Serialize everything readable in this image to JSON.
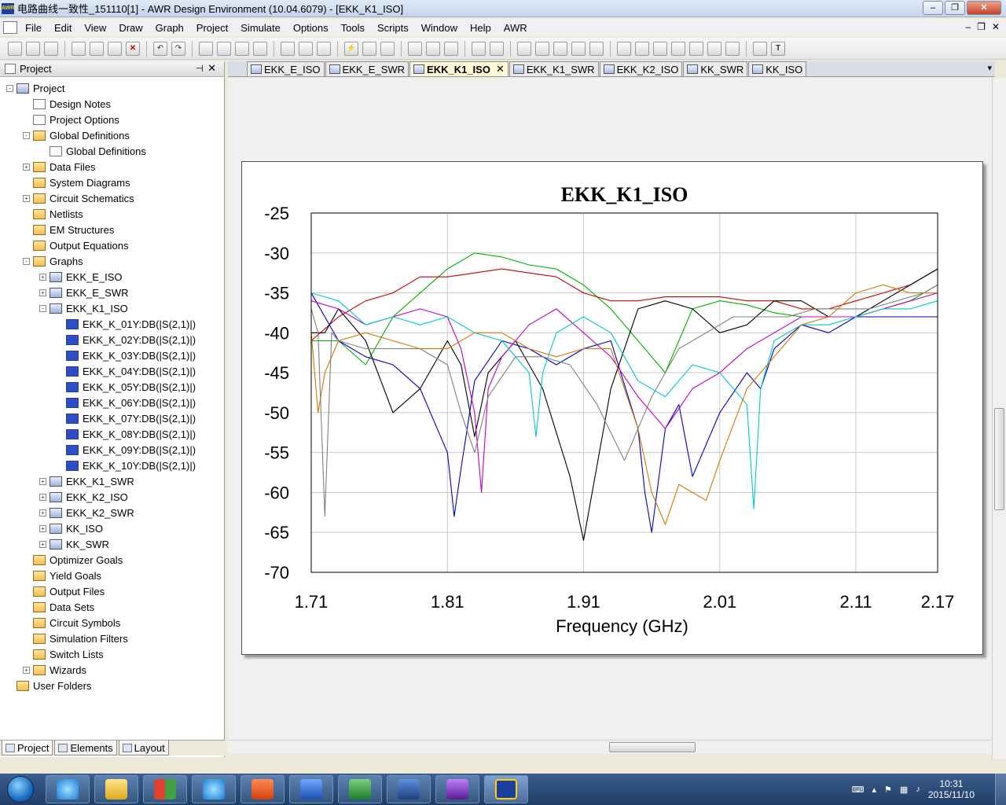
{
  "window": {
    "title": "电路曲线一致性_151110[1] - AWR Design Environment (10.04.6079) - [EKK_K1_ISO]",
    "app_icon": "AWR",
    "buttons": [
      "–",
      "❐",
      "✕"
    ]
  },
  "menu": {
    "items": [
      "File",
      "Edit",
      "View",
      "Draw",
      "Graph",
      "Project",
      "Simulate",
      "Options",
      "Tools",
      "Scripts",
      "Window",
      "Help",
      "AWR"
    ],
    "mdi_buttons": [
      "–",
      "❐",
      "✕"
    ]
  },
  "project_panel": {
    "title": "Project",
    "pin": "⊣",
    "close": "✕",
    "tree": [
      {
        "label": "Project",
        "level": 0,
        "expander": "-",
        "icon": "project-icon"
      },
      {
        "label": "Design Notes",
        "level": 1,
        "expander": "",
        "icon": "notes-icon"
      },
      {
        "label": "Project Options",
        "level": 1,
        "expander": "",
        "icon": "options-icon"
      },
      {
        "label": "Global Definitions",
        "level": 1,
        "expander": "-",
        "icon": "folder-icon"
      },
      {
        "label": "Global Definitions",
        "level": 2,
        "expander": "",
        "icon": "definitions-icon"
      },
      {
        "label": "Data Files",
        "level": 1,
        "expander": "+",
        "icon": "folder-icon"
      },
      {
        "label": "System Diagrams",
        "level": 1,
        "expander": "",
        "icon": "folder-icon"
      },
      {
        "label": "Circuit Schematics",
        "level": 1,
        "expander": "+",
        "icon": "folder-icon"
      },
      {
        "label": "Netlists",
        "level": 1,
        "expander": "",
        "icon": "folder-icon"
      },
      {
        "label": "EM Structures",
        "level": 1,
        "expander": "",
        "icon": "folder-icon"
      },
      {
        "label": "Output Equations",
        "level": 1,
        "expander": "",
        "icon": "folder-icon"
      },
      {
        "label": "Graphs",
        "level": 1,
        "expander": "-",
        "icon": "folder-icon"
      },
      {
        "label": "EKK_E_ISO",
        "level": 2,
        "expander": "+",
        "icon": "graph-icon"
      },
      {
        "label": "EKK_E_SWR",
        "level": 2,
        "expander": "+",
        "icon": "graph-icon"
      },
      {
        "label": "EKK_K1_ISO",
        "level": 2,
        "expander": "-",
        "icon": "graph-icon"
      },
      {
        "label": "EKK_K_01Y:DB(|S(2,1)|)",
        "level": 3,
        "expander": "",
        "icon": "trace-icon"
      },
      {
        "label": "EKK_K_02Y:DB(|S(2,1)|)",
        "level": 3,
        "expander": "",
        "icon": "trace-icon"
      },
      {
        "label": "EKK_K_03Y:DB(|S(2,1)|)",
        "level": 3,
        "expander": "",
        "icon": "trace-icon"
      },
      {
        "label": "EKK_K_04Y:DB(|S(2,1)|)",
        "level": 3,
        "expander": "",
        "icon": "trace-icon"
      },
      {
        "label": "EKK_K_05Y:DB(|S(2,1)|)",
        "level": 3,
        "expander": "",
        "icon": "trace-icon"
      },
      {
        "label": "EKK_K_06Y:DB(|S(2,1)|)",
        "level": 3,
        "expander": "",
        "icon": "trace-icon"
      },
      {
        "label": "EKK_K_07Y:DB(|S(2,1)|)",
        "level": 3,
        "expander": "",
        "icon": "trace-icon"
      },
      {
        "label": "EKK_K_08Y:DB(|S(2,1)|)",
        "level": 3,
        "expander": "",
        "icon": "trace-icon"
      },
      {
        "label": "EKK_K_09Y:DB(|S(2,1)|)",
        "level": 3,
        "expander": "",
        "icon": "trace-icon"
      },
      {
        "label": "EKK_K_10Y:DB(|S(2,1)|)",
        "level": 3,
        "expander": "",
        "icon": "trace-icon"
      },
      {
        "label": "EKK_K1_SWR",
        "level": 2,
        "expander": "+",
        "icon": "graph-icon"
      },
      {
        "label": "EKK_K2_ISO",
        "level": 2,
        "expander": "+",
        "icon": "graph-icon"
      },
      {
        "label": "EKK_K2_SWR",
        "level": 2,
        "expander": "+",
        "icon": "graph-icon"
      },
      {
        "label": "KK_ISO",
        "level": 2,
        "expander": "+",
        "icon": "graph-icon"
      },
      {
        "label": "KK_SWR",
        "level": 2,
        "expander": "+",
        "icon": "graph-icon"
      },
      {
        "label": "Optimizer Goals",
        "level": 1,
        "expander": "",
        "icon": "folder-icon"
      },
      {
        "label": "Yield Goals",
        "level": 1,
        "expander": "",
        "icon": "folder-icon"
      },
      {
        "label": "Output Files",
        "level": 1,
        "expander": "",
        "icon": "folder-icon"
      },
      {
        "label": "Data Sets",
        "level": 1,
        "expander": "",
        "icon": "folder-icon"
      },
      {
        "label": "Circuit Symbols",
        "level": 1,
        "expander": "",
        "icon": "folder-icon"
      },
      {
        "label": "Simulation Filters",
        "level": 1,
        "expander": "",
        "icon": "folder-icon"
      },
      {
        "label": "Switch Lists",
        "level": 1,
        "expander": "",
        "icon": "folder-icon"
      },
      {
        "label": "Wizards",
        "level": 1,
        "expander": "+",
        "icon": "folder-icon"
      },
      {
        "label": "User Folders",
        "level": 0,
        "expander": "",
        "icon": "folder-icon"
      }
    ],
    "bottom_tabs": [
      "Project",
      "Elements",
      "Layout"
    ]
  },
  "doc_tabs": [
    {
      "label": "EKK_E_ISO",
      "active": false
    },
    {
      "label": "EKK_E_SWR",
      "active": false
    },
    {
      "label": "EKK_K1_ISO",
      "active": true
    },
    {
      "label": "EKK_K1_SWR",
      "active": false
    },
    {
      "label": "EKK_K2_ISO",
      "active": false
    },
    {
      "label": "KK_SWR",
      "active": false
    },
    {
      "label": "KK_ISO",
      "active": false
    }
  ],
  "tab_close": "✕",
  "tab_menu_arrow": "▾",
  "chart_data": {
    "type": "line",
    "title": "EKK_K1_ISO",
    "xlabel": "Frequency (GHz)",
    "ylabel": "",
    "xlim": [
      1.71,
      2.17
    ],
    "ylim": [
      -70,
      -25
    ],
    "xticks": [
      "1.71",
      "1.81",
      "1.91",
      "2.01",
      "2.11",
      "2.17"
    ],
    "xtick_values": [
      1.71,
      1.81,
      1.91,
      2.01,
      2.11,
      2.17
    ],
    "yticks": [
      "-25",
      "-30",
      "-35",
      "-40",
      "-45",
      "-50",
      "-55",
      "-60",
      "-65",
      "-70"
    ],
    "ytick_values": [
      -25,
      -30,
      -35,
      -40,
      -45,
      -50,
      -55,
      -60,
      -65,
      -70
    ],
    "grid": true,
    "series": [
      {
        "color": "#00b000",
        "x": [
          1.71,
          1.73,
          1.75,
          1.77,
          1.79,
          1.81,
          1.83,
          1.85,
          1.87,
          1.89,
          1.91,
          1.93,
          1.95,
          1.97,
          1.99,
          2.01,
          2.03,
          2.05,
          2.07,
          2.09,
          2.11,
          2.13,
          2.15,
          2.17
        ],
        "y": [
          -41,
          -41,
          -44,
          -38,
          -35,
          -32,
          -30,
          -30.5,
          -31.5,
          -32,
          -34,
          -37,
          -41,
          -45,
          -37,
          -36,
          -36.5,
          -37.5,
          -38,
          -38,
          -38,
          -37,
          -36,
          -34
        ]
      },
      {
        "color": "#c00000",
        "x": [
          1.71,
          1.73,
          1.75,
          1.77,
          1.79,
          1.81,
          1.83,
          1.85,
          1.87,
          1.89,
          1.91,
          1.93,
          1.95,
          1.97,
          1.99,
          2.01,
          2.03,
          2.05,
          2.07,
          2.09,
          2.11,
          2.13,
          2.15,
          2.17
        ],
        "y": [
          -41,
          -38,
          -36,
          -35,
          -33,
          -33,
          -32.5,
          -32,
          -32.5,
          -33,
          -35,
          -36,
          -36,
          -35.5,
          -35.5,
          -35.5,
          -36,
          -36,
          -37,
          -37,
          -36,
          -35,
          -34,
          -32
        ]
      },
      {
        "color": "#000000",
        "x": [
          1.71,
          1.72,
          1.73,
          1.75,
          1.77,
          1.79,
          1.81,
          1.82,
          1.83,
          1.84,
          1.86,
          1.88,
          1.9,
          1.91,
          1.93,
          1.95,
          1.97,
          1.99,
          2.01,
          2.03,
          2.05,
          2.07,
          2.09,
          2.11,
          2.13,
          2.15,
          2.17
        ],
        "y": [
          -40,
          -40,
          -37,
          -41,
          -50,
          -47,
          -41,
          -44,
          -53,
          -45,
          -41,
          -47,
          -58,
          -66,
          -47,
          -37,
          -36,
          -37,
          -40,
          -39,
          -36,
          -36,
          -38,
          -38,
          -36,
          -34,
          -32
        ]
      },
      {
        "color": "#0000c0",
        "x": [
          1.71,
          1.73,
          1.75,
          1.77,
          1.79,
          1.81,
          1.815,
          1.82,
          1.83,
          1.85,
          1.87,
          1.89,
          1.91,
          1.93,
          1.95,
          1.955,
          1.96,
          1.97,
          1.98,
          1.99,
          2.01,
          2.03,
          2.04,
          2.05,
          2.07,
          2.09,
          2.11,
          2.13,
          2.15,
          2.17
        ],
        "y": [
          -35,
          -41,
          -43,
          -44,
          -47,
          -55,
          -63,
          -57,
          -46,
          -41,
          -42,
          -44,
          -42,
          -41,
          -52,
          -60,
          -65,
          -52,
          -49,
          -58,
          -50,
          -45,
          -47,
          -42,
          -39,
          -40,
          -38,
          -38,
          -38,
          -38
        ]
      },
      {
        "color": "#c000c0",
        "x": [
          1.71,
          1.73,
          1.75,
          1.77,
          1.79,
          1.81,
          1.82,
          1.83,
          1.835,
          1.84,
          1.85,
          1.87,
          1.89,
          1.91,
          1.93,
          1.95,
          1.97,
          1.99,
          2.01,
          2.03,
          2.05,
          2.07,
          2.09,
          2.11,
          2.13,
          2.15,
          2.17
        ],
        "y": [
          -36,
          -37,
          -39,
          -38,
          -37,
          -38,
          -42,
          -50,
          -60,
          -47,
          -43,
          -39,
          -37,
          -40,
          -43,
          -48,
          -52,
          -47,
          -45,
          -42,
          -40,
          -38,
          -38,
          -38,
          -37,
          -36,
          -35
        ]
      },
      {
        "color": "#00c8c8",
        "x": [
          1.71,
          1.73,
          1.75,
          1.77,
          1.79,
          1.81,
          1.83,
          1.85,
          1.87,
          1.875,
          1.88,
          1.89,
          1.91,
          1.93,
          1.95,
          1.97,
          1.99,
          2.01,
          2.03,
          2.035,
          2.04,
          2.05,
          2.07,
          2.09,
          2.11,
          2.13,
          2.15,
          2.17
        ],
        "y": [
          -35,
          -36,
          -39,
          -38,
          -39,
          -38,
          -40,
          -41,
          -45,
          -53,
          -45,
          -40,
          -38,
          -40,
          -46,
          -48,
          -44,
          -45,
          -49,
          -62,
          -47,
          -41,
          -39,
          -39,
          -38,
          -37,
          -37,
          -36
        ]
      },
      {
        "color": "#d07800",
        "x": [
          1.71,
          1.715,
          1.72,
          1.73,
          1.75,
          1.77,
          1.79,
          1.81,
          1.83,
          1.85,
          1.87,
          1.89,
          1.91,
          1.93,
          1.95,
          1.96,
          1.97,
          1.98,
          1.99,
          2.0,
          2.01,
          2.03,
          2.05,
          2.07,
          2.09,
          2.11,
          2.13,
          2.15,
          2.17
        ],
        "y": [
          -40,
          -50,
          -45,
          -41,
          -40,
          -41,
          -42,
          -42,
          -40,
          -40,
          -42,
          -43,
          -42,
          -42,
          -52,
          -60,
          -64,
          -59,
          -60,
          -61,
          -56,
          -47,
          -43,
          -39,
          -38,
          -35,
          -34,
          -35,
          -35
        ]
      },
      {
        "color": "#808080",
        "x": [
          1.71,
          1.715,
          1.72,
          1.725,
          1.73,
          1.75,
          1.77,
          1.79,
          1.81,
          1.82,
          1.83,
          1.84,
          1.86,
          1.88,
          1.9,
          1.92,
          1.94,
          1.96,
          1.98,
          2.0,
          2.02,
          2.04,
          2.06,
          2.08,
          2.1,
          2.12,
          2.14,
          2.16,
          2.17
        ],
        "y": [
          -37,
          -40,
          -63,
          -40,
          -41,
          -42,
          -42,
          -42,
          -44,
          -50,
          -55,
          -48,
          -43,
          -43,
          -44,
          -49,
          -56,
          -48,
          -42,
          -40,
          -38,
          -38,
          -38,
          -37,
          -37,
          -37,
          -36,
          -35,
          -34
        ]
      }
    ]
  },
  "taskbar": {
    "time": "10:31",
    "date": "2015/11/10",
    "apps": [
      "ie-icon",
      "explorer-icon",
      "apps-icon",
      "ie2-icon",
      "outlook-icon",
      "word-icon",
      "excel-icon",
      "network-icon",
      "awr-microwave-icon",
      "awr-active-icon"
    ]
  }
}
